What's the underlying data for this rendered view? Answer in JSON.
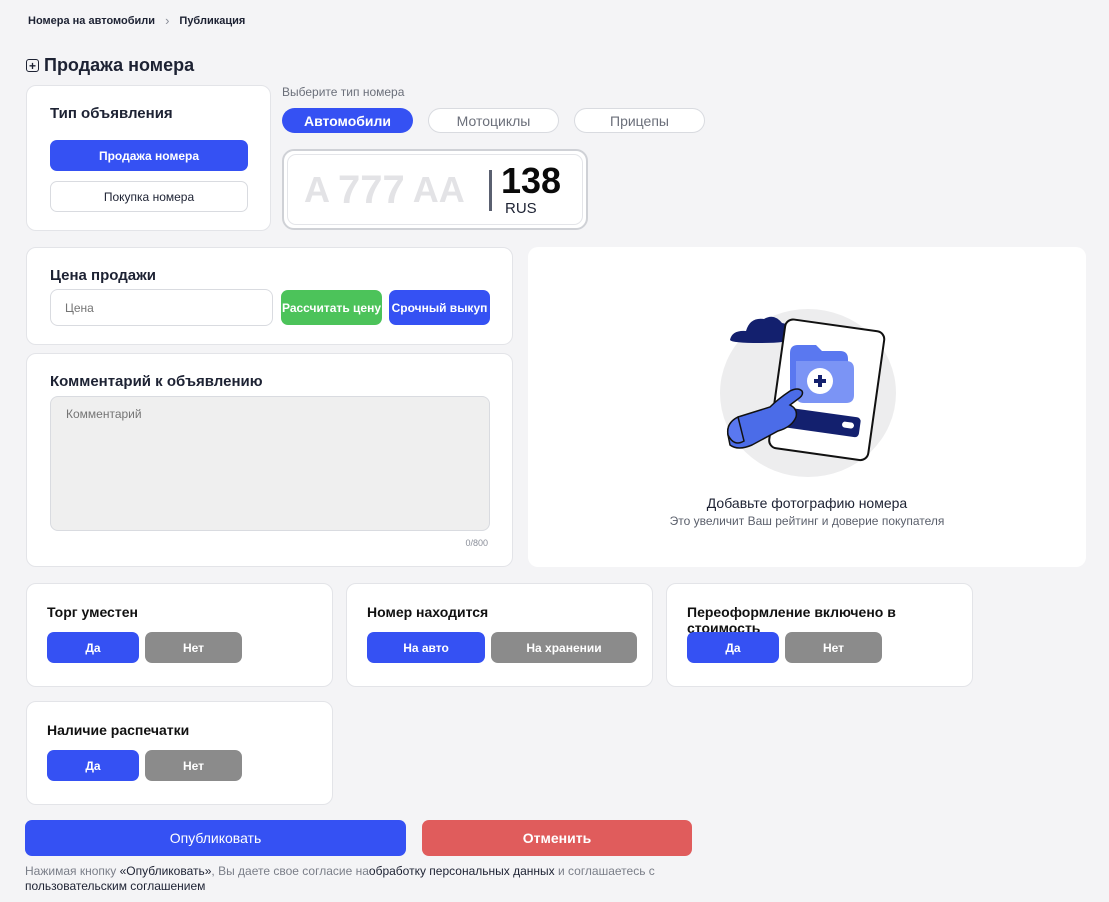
{
  "breadcrumb": {
    "parent": "Номера на автомобили",
    "separator": "›",
    "current": "Публикация"
  },
  "page_title": "Продажа номера",
  "ad_type": {
    "title": "Тип объявления",
    "sell_label": "Продажа номера",
    "buy_label": "Покупка номера"
  },
  "number_type": {
    "label": "Выберите тип номера",
    "options": [
      "Автомобили",
      "Мотоциклы",
      "Прицепы"
    ]
  },
  "plate": {
    "letter1": "А",
    "digits": "777",
    "letters2": "АА",
    "region": "138",
    "country": "RUS"
  },
  "price": {
    "title": "Цена продажи",
    "placeholder": "Цена",
    "calc_label": "Рассчитать цену",
    "urgent_label": "Срочный выкуп"
  },
  "comment": {
    "title": "Комментарий к объявлению",
    "placeholder": "Комментарий",
    "counter": "0/800"
  },
  "photo": {
    "title": "Добавьте фотографию номера",
    "subtitle": "Это увеличит Ваш рейтинг и доверие покупателя"
  },
  "bargain": {
    "title": "Торг уместен",
    "yes": "Да",
    "no": "Нет"
  },
  "location": {
    "title": "Номер находится",
    "on_car": "На авто",
    "stored": "На хранении"
  },
  "reregistration": {
    "title": "Переоформление включено в стоимость",
    "yes": "Да",
    "no": "Нет"
  },
  "printout": {
    "title": "Наличие распечатки",
    "yes": "Да",
    "no": "Нет"
  },
  "actions": {
    "publish": "Опубликовать",
    "cancel": "Отменить"
  },
  "consent": {
    "part1": "Нажимая кнопку ",
    "quoted": "«Опубликовать»",
    "part2": ", Вы даете свое согласие на",
    "link1": "обработку персональных данных",
    "part3": " и соглашаетесь с ",
    "link2": "пользовательским соглашением"
  },
  "colors": {
    "accent": "#3551f3",
    "green": "#4cc35a",
    "danger": "#e05c5c",
    "gray": "#8b8b8b",
    "navy": "#13206e"
  }
}
